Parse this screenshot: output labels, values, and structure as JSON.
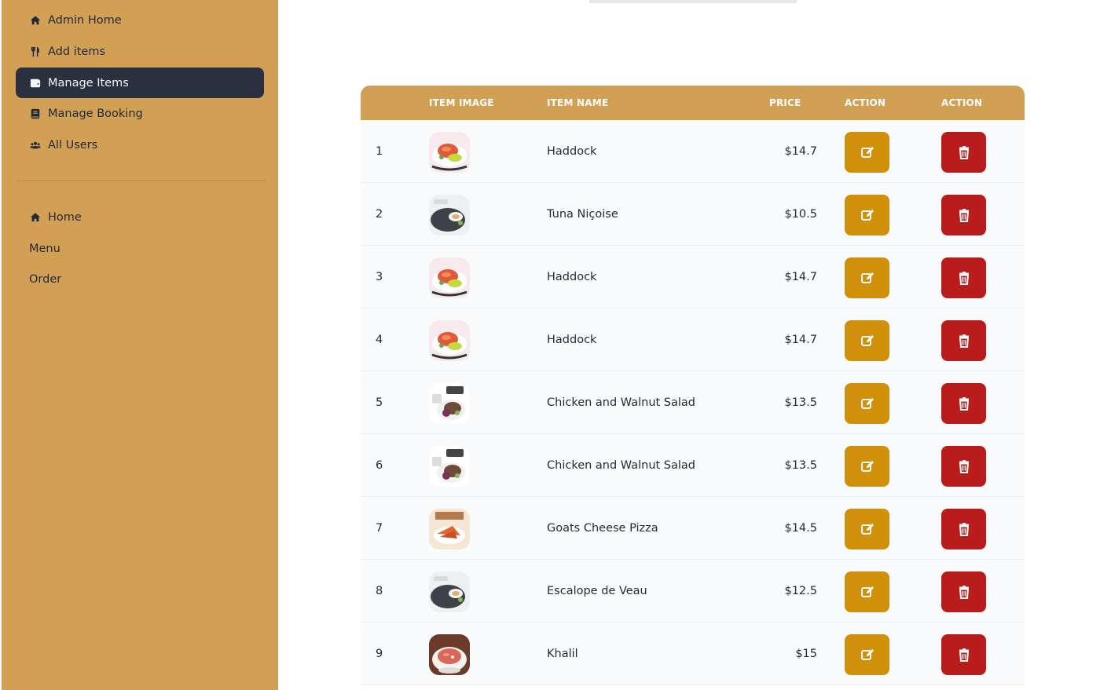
{
  "sidebar": {
    "admin_items": [
      {
        "label": "Admin Home",
        "icon": "home-icon"
      },
      {
        "label": "Add items",
        "icon": "utensils-icon"
      },
      {
        "label": "Manage Items",
        "icon": "wallet-icon",
        "active": true
      },
      {
        "label": "Manage Booking",
        "icon": "book-icon"
      },
      {
        "label": "All Users",
        "icon": "users-icon"
      }
    ],
    "site_items": [
      {
        "label": "Home",
        "icon": "home-icon"
      },
      {
        "label": "Menu"
      },
      {
        "label": "Order"
      }
    ]
  },
  "table": {
    "headers": {
      "index": "",
      "image": "ITEM IMAGE",
      "name": "ITEM NAME",
      "price": "PRICE",
      "action_edit": "ACTION",
      "action_delete": "ACTION"
    },
    "rows": [
      {
        "index": "1",
        "name": "Haddock",
        "price": "$14.7",
        "image": "salmon-dish"
      },
      {
        "index": "2",
        "name": "Tuna Niçoise",
        "price": "$10.5",
        "image": "plate-dish"
      },
      {
        "index": "3",
        "name": "Haddock",
        "price": "$14.7",
        "image": "salmon-dish"
      },
      {
        "index": "4",
        "name": "Haddock",
        "price": "$14.7",
        "image": "salmon-dish"
      },
      {
        "index": "5",
        "name": "Chicken and Walnut Salad",
        "price": "$13.5",
        "image": "salad-dish"
      },
      {
        "index": "6",
        "name": "Chicken and Walnut Salad",
        "price": "$13.5",
        "image": "salad-dish"
      },
      {
        "index": "7",
        "name": "Goats Cheese Pizza",
        "price": "$14.5",
        "image": "pizza-dish"
      },
      {
        "index": "8",
        "name": "Escalope de Veau",
        "price": "$12.5",
        "image": "plate-dish"
      },
      {
        "index": "9",
        "name": "Khalil",
        "price": "$15",
        "image": "soup-dish"
      }
    ]
  },
  "colors": {
    "sidebar_bg": "#d1a054",
    "active_bg": "#2a3040",
    "header_bg": "#d1a054",
    "edit_btn": "#d0900a",
    "delete_btn": "#b91c1c"
  }
}
